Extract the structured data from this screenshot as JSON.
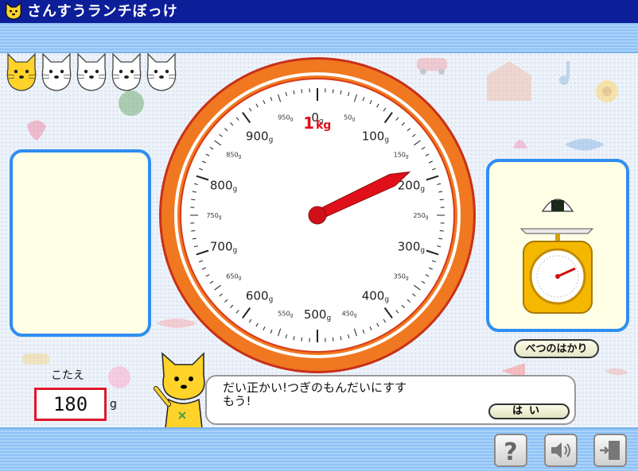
{
  "app": {
    "title": "さんすうランチぼっけ"
  },
  "lives": [
    {
      "state": "filled",
      "color": "#ffd32a"
    },
    {
      "state": "empty",
      "color": "#ffffff"
    },
    {
      "state": "empty",
      "color": "#ffffff"
    },
    {
      "state": "empty",
      "color": "#ffffff"
    },
    {
      "state": "empty",
      "color": "#ffffff"
    }
  ],
  "scale": {
    "max_label": "1",
    "max_unit": "kg",
    "major_labels": [
      {
        "value": 0,
        "text": "0"
      },
      {
        "value": 100,
        "text": "100"
      },
      {
        "value": 200,
        "text": "200"
      },
      {
        "value": 300,
        "text": "300"
      },
      {
        "value": 400,
        "text": "400"
      },
      {
        "value": 500,
        "text": "500"
      },
      {
        "value": 600,
        "text": "600"
      },
      {
        "value": 700,
        "text": "700"
      },
      {
        "value": 800,
        "text": "800"
      },
      {
        "value": 900,
        "text": "900"
      }
    ],
    "minor_labels": [
      {
        "value": 50,
        "text": "50"
      },
      {
        "value": 150,
        "text": "150"
      },
      {
        "value": 250,
        "text": "250"
      },
      {
        "value": 350,
        "text": "350"
      },
      {
        "value": 450,
        "text": "450"
      },
      {
        "value": 550,
        "text": "550"
      },
      {
        "value": 650,
        "text": "650"
      },
      {
        "value": 750,
        "text": "750"
      },
      {
        "value": 850,
        "text": "850"
      },
      {
        "value": 950,
        "text": "950"
      }
    ],
    "unit": "g",
    "reading": 180,
    "max_value": 1000,
    "needle_color": "#e0101a",
    "rim_color": "#f07820"
  },
  "other_scale": {
    "button_label": "べつのはかり"
  },
  "answer": {
    "label": "こたえ",
    "value": "180",
    "unit": "g"
  },
  "dialog": {
    "message": "だい正かい!つぎのもんだいにすす\nもう!",
    "yes_label": "はい"
  },
  "toolbar": {
    "help_icon": "question-icon",
    "sound_icon": "speaker-icon",
    "exit_icon": "exit-door-icon"
  },
  "colors": {
    "header": "#0d1e99",
    "panel_border": "#2f8ef2",
    "panel_fill": "#ffffe6",
    "answer_border": "#e0182b"
  }
}
